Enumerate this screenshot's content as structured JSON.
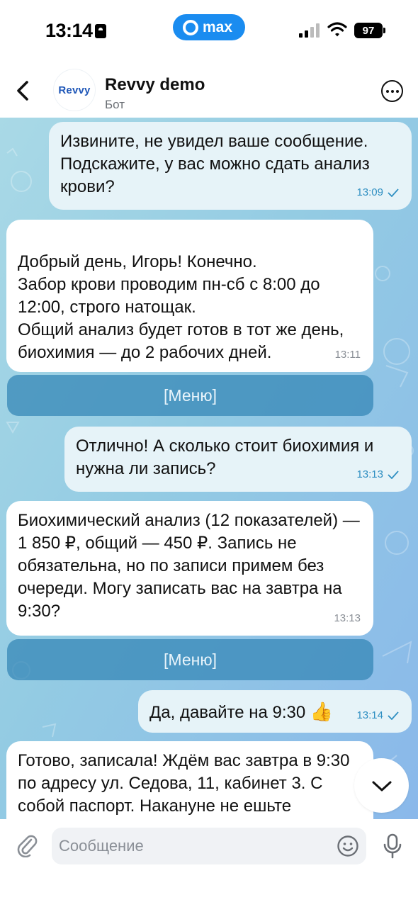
{
  "status_bar": {
    "time": "13:14",
    "app_badge": "max",
    "battery": "97"
  },
  "header": {
    "avatar_text": "Revvy",
    "title": "Revvy demo",
    "subtitle": "Бот"
  },
  "messages": [
    {
      "from": "user",
      "text": "Извините, не увидел ваше сообщение. Подскажите, у вас можно сдать анализ крови?",
      "time": "13:09",
      "read": true
    },
    {
      "from": "bot",
      "text": "Добрый день, Игорь! Конечно.\nЗабор крови проводим пн-сб с 8:00 до 12:00, строго натощак.\nОбщий анализ будет готов в тот же день, биохимия — до 2 рабочих дней.",
      "time": "13:11"
    },
    {
      "from": "user",
      "text": "Отлично! А сколько стоит биохимия и нужна ли запись?",
      "time": "13:13",
      "read": true
    },
    {
      "from": "bot",
      "text": "Биохимический анализ (12 показателей) — 1 850 ₽, общий — 450 ₽. Запись не обязательна, но по записи примем без очереди. Могу записать вас на завтра на 9:30?",
      "time": "13:13"
    },
    {
      "from": "user",
      "text": "Да, давайте на 9:30",
      "emoji": "👍",
      "time": "13:14",
      "read": true
    },
    {
      "from": "bot",
      "text": "Готово, записала! Ждём вас завтра в 9:30 по адресу ул. Седова, 11, кабинет 3. С собой паспорт. Накануне не ешьте"
    }
  ],
  "menu_buttons": [
    "[Меню]",
    "[Меню]"
  ],
  "composer": {
    "placeholder": "Сообщение",
    "value": ""
  },
  "icons": [
    "lock-icon",
    "cellular-icon",
    "wifi-icon",
    "battery-icon",
    "back-icon",
    "more-icon",
    "check-icon",
    "chevron-down-icon",
    "paperclip-icon",
    "smile-icon",
    "mic-icon"
  ],
  "colors": {
    "accent": "#1a8cf0",
    "outgoing_bubble": "#e6f3f8",
    "incoming_bubble": "#ffffff",
    "menu_button": "#3587b7",
    "read_check": "#2f8fc2"
  }
}
